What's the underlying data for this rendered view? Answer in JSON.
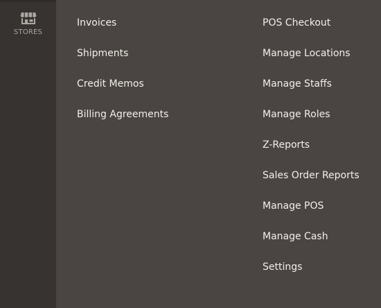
{
  "sidebar": {
    "stores": {
      "label": "STORES",
      "icon": "storefront-icon"
    }
  },
  "submenu": {
    "left_items": [
      {
        "label": "Invoices"
      },
      {
        "label": "Shipments"
      },
      {
        "label": "Credit Memos"
      },
      {
        "label": "Billing Agreements"
      }
    ],
    "right_items": [
      {
        "label": "POS Checkout"
      },
      {
        "label": "Manage Locations"
      },
      {
        "label": "Manage Staffs"
      },
      {
        "label": "Manage Roles"
      },
      {
        "label": "Z-Reports"
      },
      {
        "label": "Sales Order Reports"
      },
      {
        "label": "Manage POS"
      },
      {
        "label": "Manage Cash"
      },
      {
        "label": "Settings"
      }
    ]
  },
  "colors": {
    "sidebar_bg": "#373330",
    "panel_bg": "#4a4542",
    "menu_text": "#f2efea",
    "sidebar_text": "#aaa6a0"
  }
}
